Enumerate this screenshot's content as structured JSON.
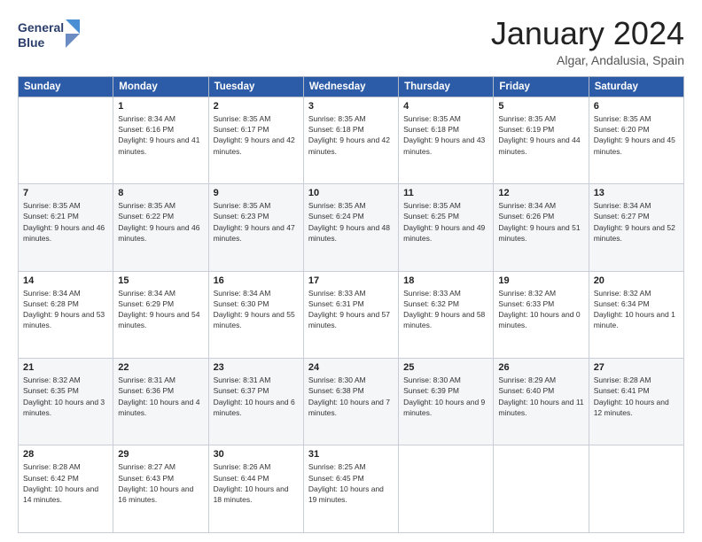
{
  "logo": {
    "line1": "General",
    "line2": "Blue"
  },
  "header": {
    "month": "January 2024",
    "location": "Algar, Andalusia, Spain"
  },
  "columns": [
    "Sunday",
    "Monday",
    "Tuesday",
    "Wednesday",
    "Thursday",
    "Friday",
    "Saturday"
  ],
  "weeks": [
    [
      {
        "day": "",
        "sunrise": "",
        "sunset": "",
        "daylight": ""
      },
      {
        "day": "1",
        "sunrise": "Sunrise: 8:34 AM",
        "sunset": "Sunset: 6:16 PM",
        "daylight": "Daylight: 9 hours and 41 minutes."
      },
      {
        "day": "2",
        "sunrise": "Sunrise: 8:35 AM",
        "sunset": "Sunset: 6:17 PM",
        "daylight": "Daylight: 9 hours and 42 minutes."
      },
      {
        "day": "3",
        "sunrise": "Sunrise: 8:35 AM",
        "sunset": "Sunset: 6:18 PM",
        "daylight": "Daylight: 9 hours and 42 minutes."
      },
      {
        "day": "4",
        "sunrise": "Sunrise: 8:35 AM",
        "sunset": "Sunset: 6:18 PM",
        "daylight": "Daylight: 9 hours and 43 minutes."
      },
      {
        "day": "5",
        "sunrise": "Sunrise: 8:35 AM",
        "sunset": "Sunset: 6:19 PM",
        "daylight": "Daylight: 9 hours and 44 minutes."
      },
      {
        "day": "6",
        "sunrise": "Sunrise: 8:35 AM",
        "sunset": "Sunset: 6:20 PM",
        "daylight": "Daylight: 9 hours and 45 minutes."
      }
    ],
    [
      {
        "day": "7",
        "sunrise": "Sunrise: 8:35 AM",
        "sunset": "Sunset: 6:21 PM",
        "daylight": "Daylight: 9 hours and 46 minutes."
      },
      {
        "day": "8",
        "sunrise": "Sunrise: 8:35 AM",
        "sunset": "Sunset: 6:22 PM",
        "daylight": "Daylight: 9 hours and 46 minutes."
      },
      {
        "day": "9",
        "sunrise": "Sunrise: 8:35 AM",
        "sunset": "Sunset: 6:23 PM",
        "daylight": "Daylight: 9 hours and 47 minutes."
      },
      {
        "day": "10",
        "sunrise": "Sunrise: 8:35 AM",
        "sunset": "Sunset: 6:24 PM",
        "daylight": "Daylight: 9 hours and 48 minutes."
      },
      {
        "day": "11",
        "sunrise": "Sunrise: 8:35 AM",
        "sunset": "Sunset: 6:25 PM",
        "daylight": "Daylight: 9 hours and 49 minutes."
      },
      {
        "day": "12",
        "sunrise": "Sunrise: 8:34 AM",
        "sunset": "Sunset: 6:26 PM",
        "daylight": "Daylight: 9 hours and 51 minutes."
      },
      {
        "day": "13",
        "sunrise": "Sunrise: 8:34 AM",
        "sunset": "Sunset: 6:27 PM",
        "daylight": "Daylight: 9 hours and 52 minutes."
      }
    ],
    [
      {
        "day": "14",
        "sunrise": "Sunrise: 8:34 AM",
        "sunset": "Sunset: 6:28 PM",
        "daylight": "Daylight: 9 hours and 53 minutes."
      },
      {
        "day": "15",
        "sunrise": "Sunrise: 8:34 AM",
        "sunset": "Sunset: 6:29 PM",
        "daylight": "Daylight: 9 hours and 54 minutes."
      },
      {
        "day": "16",
        "sunrise": "Sunrise: 8:34 AM",
        "sunset": "Sunset: 6:30 PM",
        "daylight": "Daylight: 9 hours and 55 minutes."
      },
      {
        "day": "17",
        "sunrise": "Sunrise: 8:33 AM",
        "sunset": "Sunset: 6:31 PM",
        "daylight": "Daylight: 9 hours and 57 minutes."
      },
      {
        "day": "18",
        "sunrise": "Sunrise: 8:33 AM",
        "sunset": "Sunset: 6:32 PM",
        "daylight": "Daylight: 9 hours and 58 minutes."
      },
      {
        "day": "19",
        "sunrise": "Sunrise: 8:32 AM",
        "sunset": "Sunset: 6:33 PM",
        "daylight": "Daylight: 10 hours and 0 minutes."
      },
      {
        "day": "20",
        "sunrise": "Sunrise: 8:32 AM",
        "sunset": "Sunset: 6:34 PM",
        "daylight": "Daylight: 10 hours and 1 minute."
      }
    ],
    [
      {
        "day": "21",
        "sunrise": "Sunrise: 8:32 AM",
        "sunset": "Sunset: 6:35 PM",
        "daylight": "Daylight: 10 hours and 3 minutes."
      },
      {
        "day": "22",
        "sunrise": "Sunrise: 8:31 AM",
        "sunset": "Sunset: 6:36 PM",
        "daylight": "Daylight: 10 hours and 4 minutes."
      },
      {
        "day": "23",
        "sunrise": "Sunrise: 8:31 AM",
        "sunset": "Sunset: 6:37 PM",
        "daylight": "Daylight: 10 hours and 6 minutes."
      },
      {
        "day": "24",
        "sunrise": "Sunrise: 8:30 AM",
        "sunset": "Sunset: 6:38 PM",
        "daylight": "Daylight: 10 hours and 7 minutes."
      },
      {
        "day": "25",
        "sunrise": "Sunrise: 8:30 AM",
        "sunset": "Sunset: 6:39 PM",
        "daylight": "Daylight: 10 hours and 9 minutes."
      },
      {
        "day": "26",
        "sunrise": "Sunrise: 8:29 AM",
        "sunset": "Sunset: 6:40 PM",
        "daylight": "Daylight: 10 hours and 11 minutes."
      },
      {
        "day": "27",
        "sunrise": "Sunrise: 8:28 AM",
        "sunset": "Sunset: 6:41 PM",
        "daylight": "Daylight: 10 hours and 12 minutes."
      }
    ],
    [
      {
        "day": "28",
        "sunrise": "Sunrise: 8:28 AM",
        "sunset": "Sunset: 6:42 PM",
        "daylight": "Daylight: 10 hours and 14 minutes."
      },
      {
        "day": "29",
        "sunrise": "Sunrise: 8:27 AM",
        "sunset": "Sunset: 6:43 PM",
        "daylight": "Daylight: 10 hours and 16 minutes."
      },
      {
        "day": "30",
        "sunrise": "Sunrise: 8:26 AM",
        "sunset": "Sunset: 6:44 PM",
        "daylight": "Daylight: 10 hours and 18 minutes."
      },
      {
        "day": "31",
        "sunrise": "Sunrise: 8:25 AM",
        "sunset": "Sunset: 6:45 PM",
        "daylight": "Daylight: 10 hours and 19 minutes."
      },
      {
        "day": "",
        "sunrise": "",
        "sunset": "",
        "daylight": ""
      },
      {
        "day": "",
        "sunrise": "",
        "sunset": "",
        "daylight": ""
      },
      {
        "day": "",
        "sunrise": "",
        "sunset": "",
        "daylight": ""
      }
    ]
  ]
}
